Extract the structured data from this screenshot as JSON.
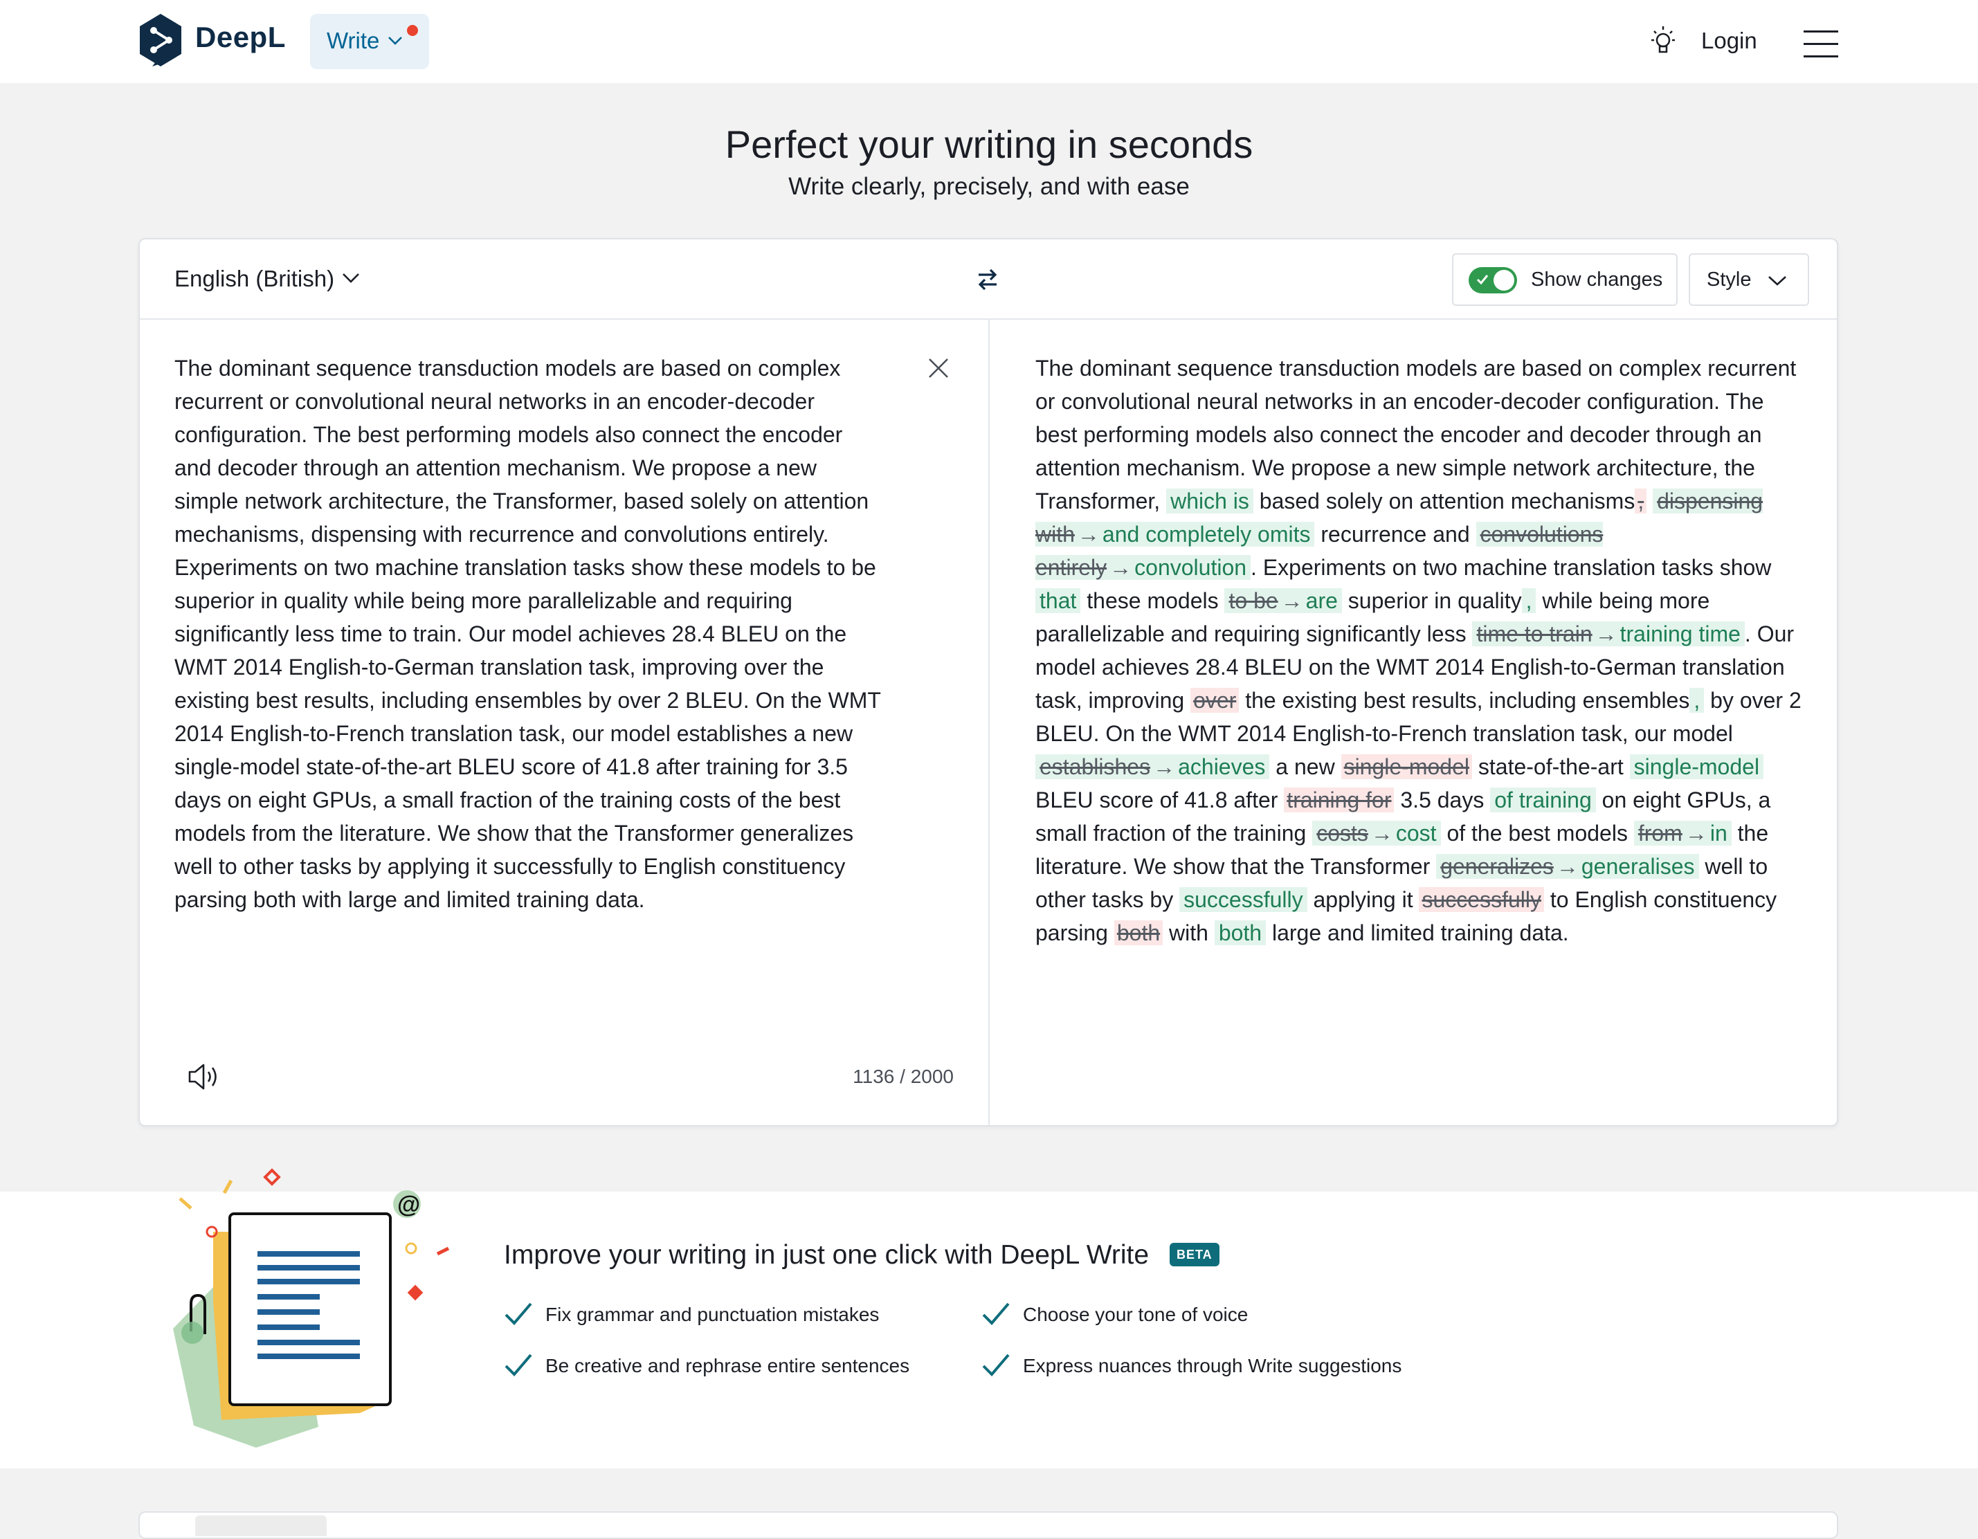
{
  "header": {
    "brand": "DeepL",
    "write_label": "Write",
    "login_label": "Login"
  },
  "hero": {
    "title": "Perfect your writing in seconds",
    "subtitle": "Write clearly, precisely, and with ease"
  },
  "editor": {
    "language": "English (British)",
    "show_changes_label": "Show changes",
    "show_changes_on": true,
    "style_label": "Style",
    "source_text": "The dominant sequence transduction models are based on complex\nrecurrent or convolutional neural networks in an encoder-decoder\nconfiguration. The best performing models also connect the encoder\nand decoder through an attention mechanism. We propose a new\nsimple network architecture, the Transformer, based solely on attention\nmechanisms, dispensing with recurrence and convolutions entirely.\nExperiments on two machine translation tasks show these models to be\nsuperior in quality while being more parallelizable and requiring\nsignificantly less time to train. Our model achieves 28.4 BLEU on the\nWMT 2014 English-to-German translation task, improving over the\nexisting best results, including ensembles by over 2 BLEU. On the WMT\n2014 English-to-French translation task, our model establishes a new\nsingle-model state-of-the-art BLEU score of 41.8 after training for 3.5\ndays on eight GPUs, a small fraction of the training costs of the best\nmodels from the literature. We show that the Transformer generalizes\nwell to other tasks by applying it successfully to English constituency\nparsing both with large and limited training data.",
    "char_count": "1136 / 2000",
    "output_segments": [
      {
        "t": "text",
        "v": "The dominant sequence transduction models are based on complex recurrent or convolutional neural networks in an encoder-decoder configuration. The best performing models also connect the encoder and decoder through an attention mechanism. We propose a new simple network architecture, the Transformer, "
      },
      {
        "t": "ins",
        "v": "which is"
      },
      {
        "t": "text",
        "v": " based solely on attention mechanisms"
      },
      {
        "t": "del",
        "v": ","
      },
      {
        "t": "text",
        "v": " "
      },
      {
        "t": "rep",
        "old": "dispensing with",
        "new": "and completely omits"
      },
      {
        "t": "text",
        "v": " recurrence and "
      },
      {
        "t": "rep",
        "old": "convolutions entirely",
        "new": "convolution"
      },
      {
        "t": "text",
        "v": ". Experiments on two machine translation tasks show "
      },
      {
        "t": "ins",
        "v": "that"
      },
      {
        "t": "text",
        "v": " these models "
      },
      {
        "t": "rep",
        "old": "to be",
        "new": "are"
      },
      {
        "t": "text",
        "v": " superior in quality"
      },
      {
        "t": "ins",
        "v": ","
      },
      {
        "t": "text",
        "v": " while being more parallelizable and requiring significantly less "
      },
      {
        "t": "rep",
        "old": "time to train",
        "new": "training time"
      },
      {
        "t": "text",
        "v": ". Our model achieves 28.4 BLEU on the WMT 2014 English-to-German translation task, improving "
      },
      {
        "t": "del",
        "v": "over"
      },
      {
        "t": "text",
        "v": " the existing best results, including ensembles"
      },
      {
        "t": "ins",
        "v": ","
      },
      {
        "t": "text",
        "v": " by over 2 BLEU. On the WMT 2014 English-to-French translation task, our model "
      },
      {
        "t": "rep",
        "old": "establishes",
        "new": "achieves"
      },
      {
        "t": "text",
        "v": " a new "
      },
      {
        "t": "del",
        "v": "single-model"
      },
      {
        "t": "text",
        "v": " state-of-the-art "
      },
      {
        "t": "ins",
        "v": "single-model"
      },
      {
        "t": "text",
        "v": " BLEU score of 41.8 after "
      },
      {
        "t": "del",
        "v": "training for"
      },
      {
        "t": "text",
        "v": " 3.5 days "
      },
      {
        "t": "ins",
        "v": "of training"
      },
      {
        "t": "text",
        "v": " on eight GPUs, a small fraction of the training "
      },
      {
        "t": "rep",
        "old": "costs",
        "new": "cost"
      },
      {
        "t": "text",
        "v": " of the best models "
      },
      {
        "t": "rep",
        "old": "from",
        "new": "in"
      },
      {
        "t": "text",
        "v": " the literature. We show that the Transformer "
      },
      {
        "t": "rep",
        "old": "generalizes",
        "new": "generalises"
      },
      {
        "t": "text",
        "v": " well to other tasks by "
      },
      {
        "t": "ins",
        "v": "successfully"
      },
      {
        "t": "text",
        "v": " applying it "
      },
      {
        "t": "del",
        "v": "successfully"
      },
      {
        "t": "text",
        "v": " to English constituency parsing "
      },
      {
        "t": "del",
        "v": "both"
      },
      {
        "t": "text",
        "v": " with "
      },
      {
        "t": "ins",
        "v": "both"
      },
      {
        "t": "text",
        "v": " large and limited training data."
      }
    ]
  },
  "promo": {
    "title": "Improve your writing in just one click with DeepL Write",
    "badge": "BETA",
    "features": [
      "Fix grammar and punctuation mistakes",
      "Be creative and rephrase entire sentences",
      "Choose your tone of voice",
      "Express nuances through Write suggestions"
    ]
  },
  "colors": {
    "brand_navy": "#0f2b46",
    "accent_blue": "#006494",
    "insert_bg": "#e3f4ec",
    "insert_text": "#1e7e55",
    "delete_bg": "#fce6e6",
    "toggle_on": "#2f9a4d",
    "check_teal": "#0f6d7b"
  },
  "icons": {
    "logo": "deepl-logo-icon",
    "write_menu": "chevron-down-icon",
    "bulb": "lightbulb-icon",
    "menu": "hamburger-menu-icon",
    "swap": "swap-arrows-icon",
    "clear": "close-icon",
    "speaker": "speaker-icon",
    "check": "checkmark-icon"
  }
}
